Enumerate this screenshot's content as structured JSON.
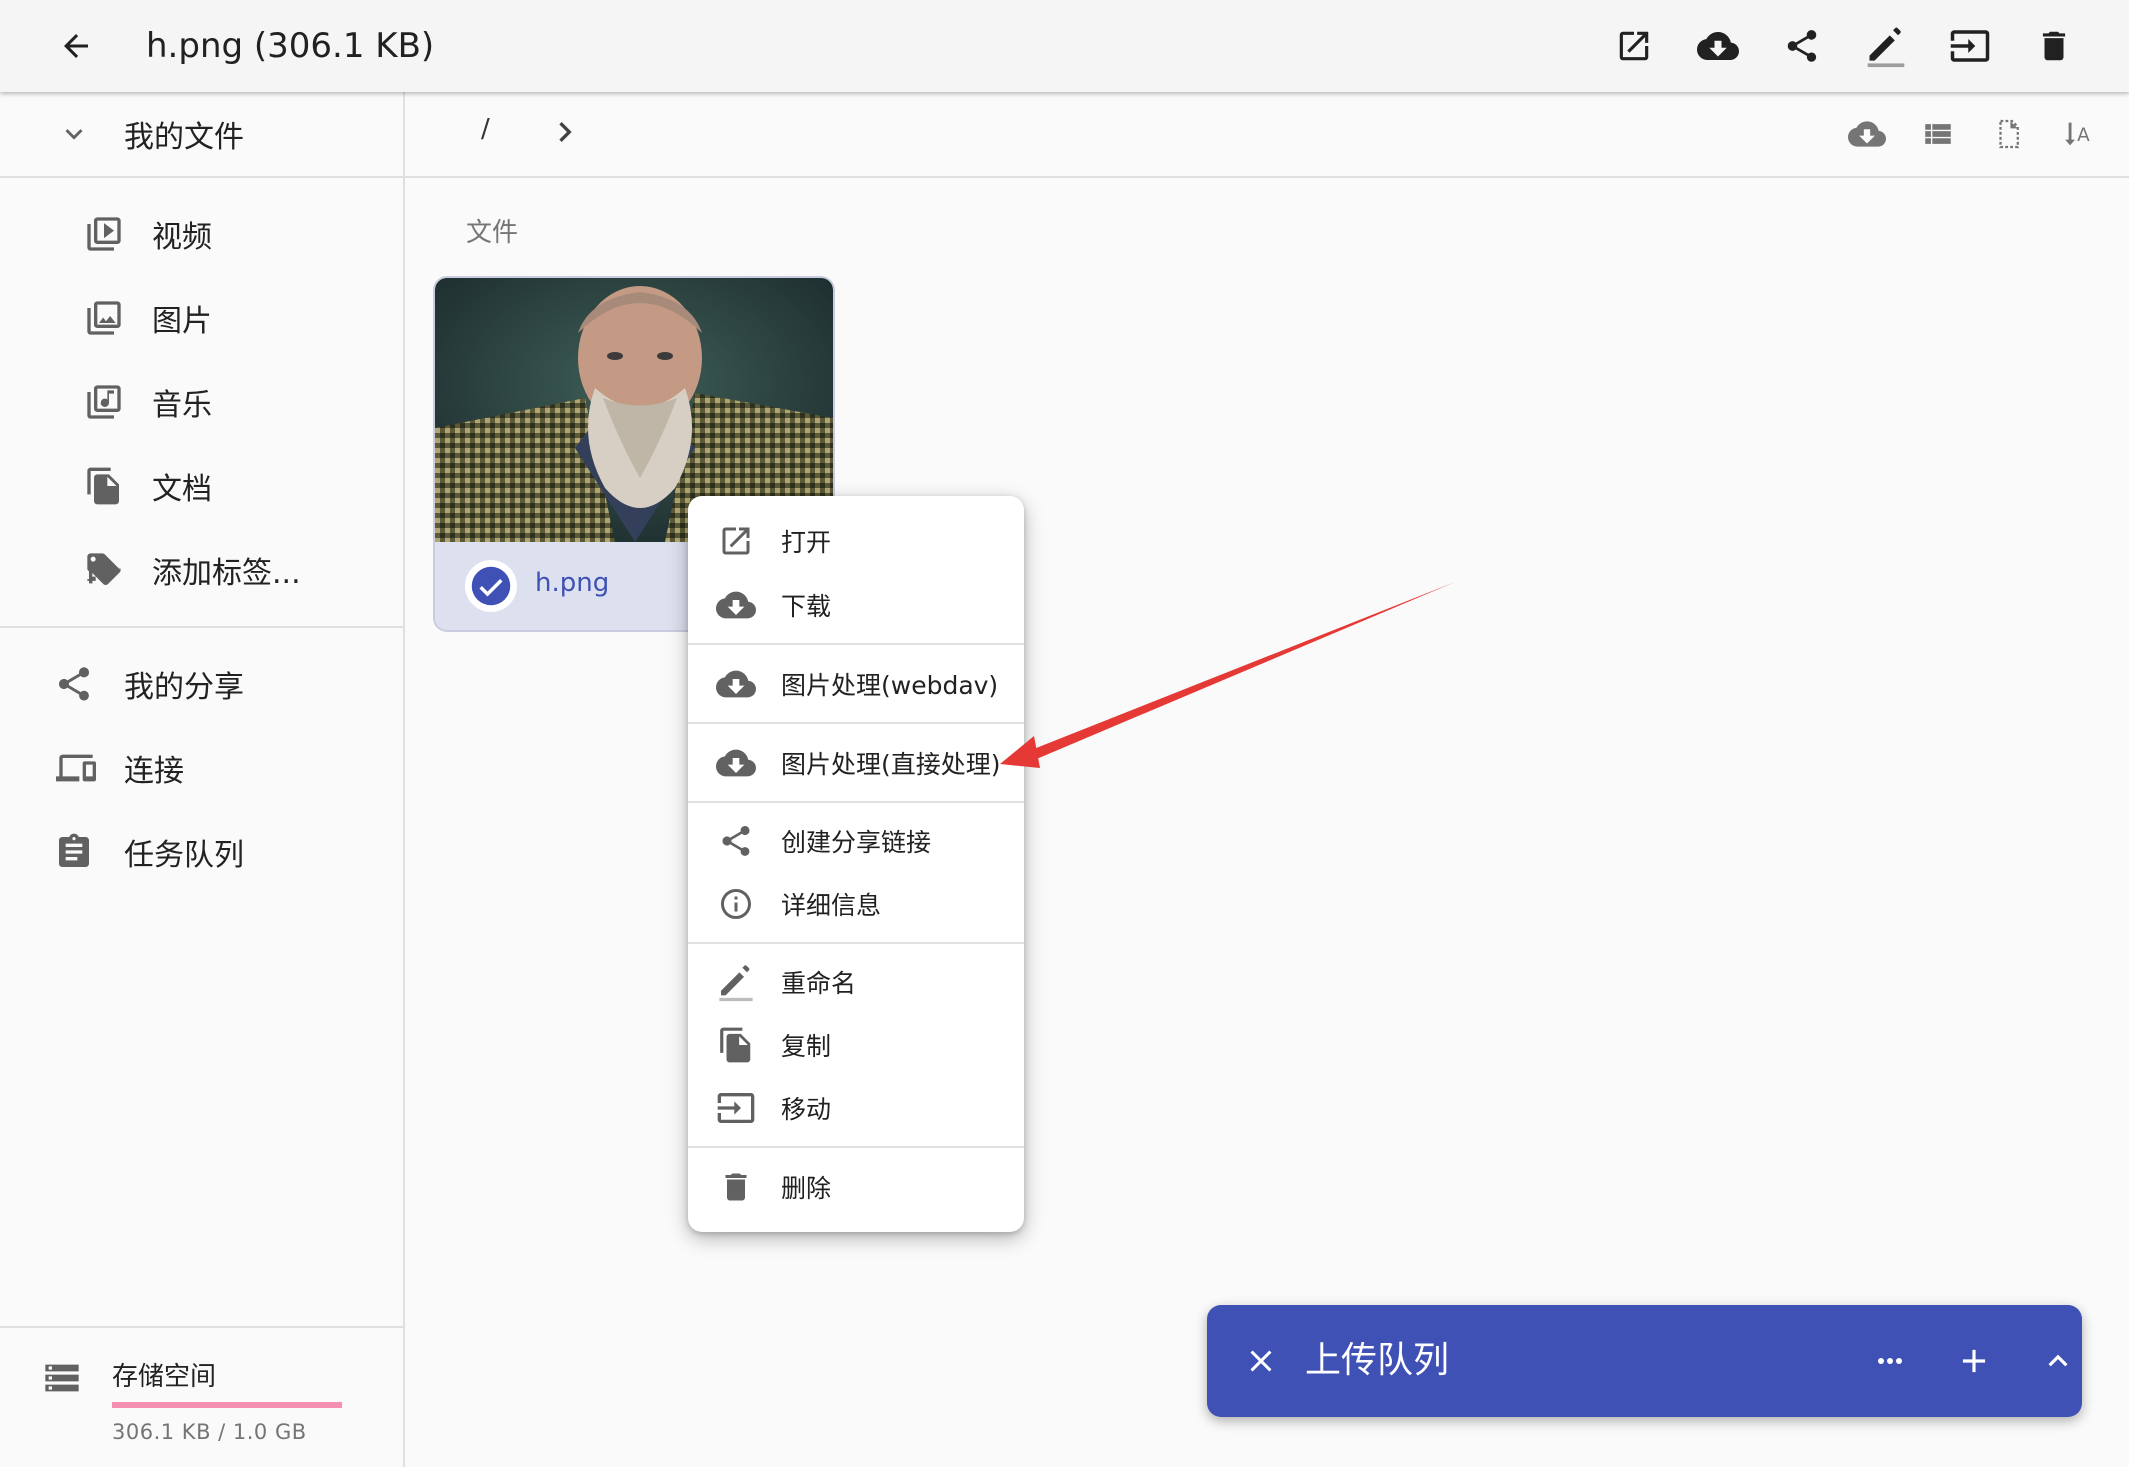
{
  "header": {
    "title": "h.png (306.1 KB)",
    "actions": [
      "open-in-new-icon",
      "download-icon",
      "share-icon",
      "rename-icon",
      "move-icon",
      "delete-icon"
    ]
  },
  "sidebar": {
    "my_files": "我的文件",
    "categories": [
      {
        "label": "视频",
        "icon": "video-library-icon"
      },
      {
        "label": "图片",
        "icon": "photo-library-icon"
      },
      {
        "label": "音乐",
        "icon": "music-library-icon"
      },
      {
        "label": "文档",
        "icon": "documents-icon"
      },
      {
        "label": "添加标签...",
        "icon": "add-tag-icon"
      }
    ],
    "nav": [
      {
        "label": "我的分享",
        "icon": "share-icon"
      },
      {
        "label": "连接",
        "icon": "devices-icon"
      },
      {
        "label": "任务队列",
        "icon": "assignment-icon"
      }
    ],
    "storage": {
      "label": "存储空间",
      "usage": "306.1 KB / 1.0 GB",
      "used_fraction": 0.0003
    }
  },
  "breadcrumb": {
    "root": "/",
    "tools": [
      "cloud-download-icon",
      "list-view-icon",
      "file-outline-icon",
      "sort-text-icon"
    ]
  },
  "main": {
    "section_label": "文件",
    "file": {
      "name": "h.png",
      "selected": true
    }
  },
  "context_menu": {
    "groups": [
      [
        {
          "label": "打开",
          "icon": "open-in-new-icon"
        },
        {
          "label": "下载",
          "icon": "cloud-download-icon"
        }
      ],
      [
        {
          "label": "图片处理(webdav)",
          "icon": "cloud-download-icon"
        }
      ],
      [
        {
          "label": "图片处理(直接处理)",
          "icon": "cloud-download-icon"
        }
      ],
      [
        {
          "label": "创建分享链接",
          "icon": "share-icon"
        },
        {
          "label": "详细信息",
          "icon": "info-icon"
        }
      ],
      [
        {
          "label": "重命名",
          "icon": "rename-icon"
        },
        {
          "label": "复制",
          "icon": "copy-icon"
        },
        {
          "label": "移动",
          "icon": "move-icon"
        }
      ],
      [
        {
          "label": "删除",
          "icon": "delete-icon"
        }
      ]
    ]
  },
  "upload_queue": {
    "title": "上传队列",
    "buttons": [
      "close-icon",
      "more-icon",
      "add-icon",
      "expand-icon"
    ]
  },
  "colors": {
    "accent": "#3f51b5",
    "annotation_arrow": "#e53935",
    "storage_bar": "#f48fb1",
    "topbar_bg": "#f5f5f5",
    "icon_gray": "#616161"
  }
}
